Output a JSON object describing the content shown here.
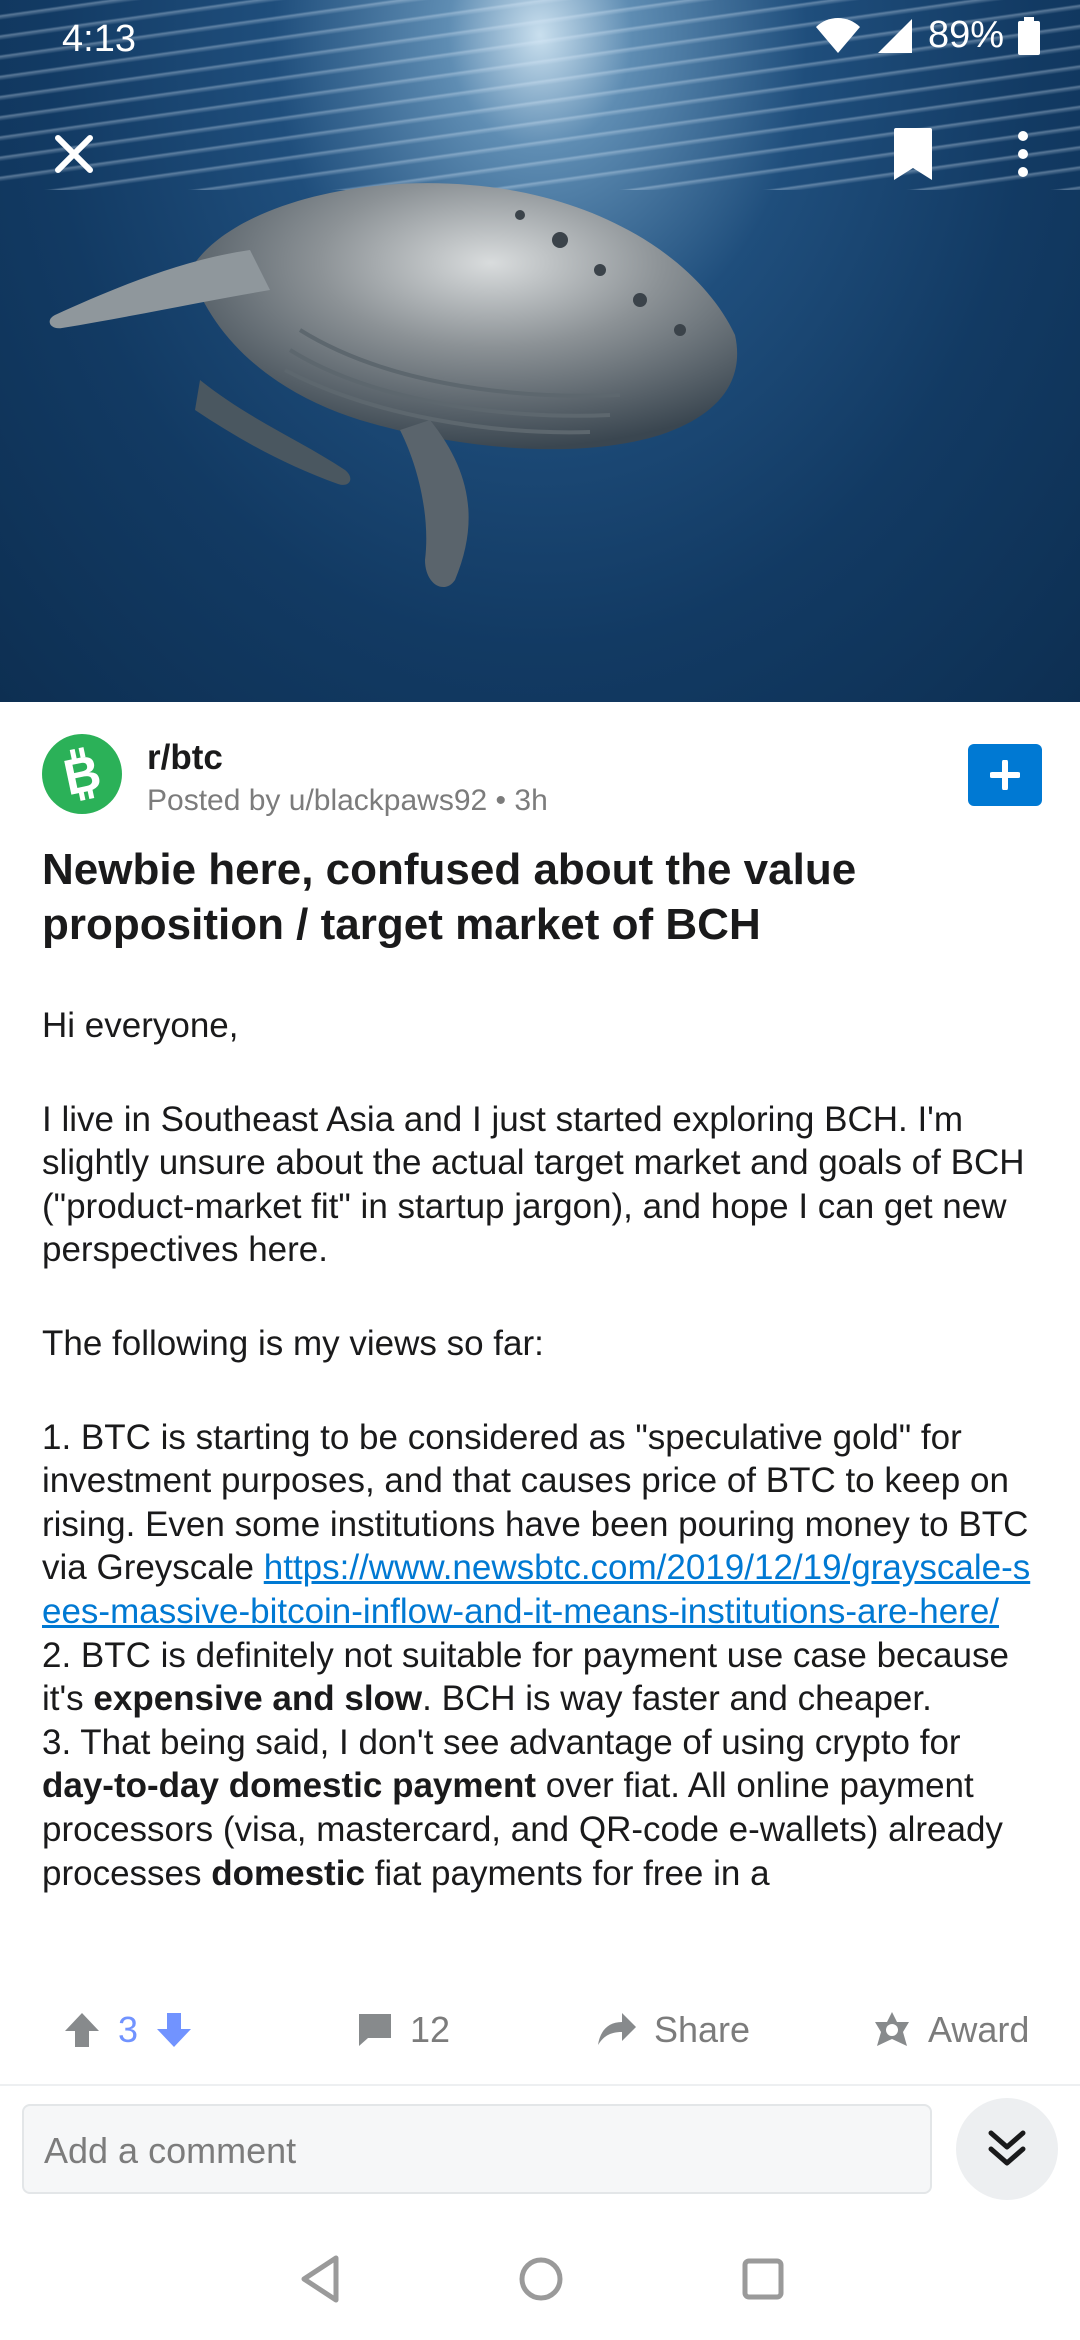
{
  "status_bar": {
    "time": "4:13",
    "battery": "89%"
  },
  "header": {
    "close_icon": "close-icon",
    "bookmark_icon": "bookmark-icon",
    "more_icon": "more-vertical-icon"
  },
  "post": {
    "subreddit": "r/btc",
    "posted_by": "Posted by u/blackpaws92 • 3h",
    "title": "Newbie here, confused about the value proposition / target market of BCH",
    "p1": "Hi everyone,",
    "p2": "I live in Southeast Asia and I just started exploring BCH. I'm slightly unsure about the actual target market and goals of BCH (\"product-market fit\" in startup jargon), and hope I can get new perspectives here.",
    "p3": "The following is my views so far:",
    "item1_text": "1. BTC is starting to be considered as \"speculative gold\" for investment purposes, and that causes price of BTC to keep on rising. Even some institutions have been pouring money to BTC via Greyscale ",
    "item1_link": "https://www.newsbtc.com/2019/12/19/grayscale-sees-massive-bitcoin-inflow-and-it-means-institutions-are-here/",
    "item2_a": "2. BTC is definitely not suitable for payment use case because it's ",
    "item2_bold": "expensive and slow",
    "item2_b": ". BCH is way faster and cheaper.",
    "item3_a": "3. That being said, I don't see advantage of using crypto for ",
    "item3_bold": "day-to-day domestic payment",
    "item3_b": " over fiat. All online payment processors (visa, mastercard, and QR-code e-wallets) already processes ",
    "item3_bold2": "domestic",
    "item3_c": " fiat payments for free in a"
  },
  "actions": {
    "score": "3",
    "comments": "12",
    "share": "Share",
    "award": "Award"
  },
  "comment": {
    "placeholder": "Add a comment"
  },
  "colors": {
    "accent": "#0079d3",
    "subreddit_icon": "#2bb158",
    "muted": "#7c7c7c"
  }
}
